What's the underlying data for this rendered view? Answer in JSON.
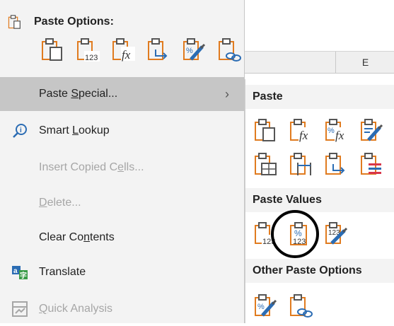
{
  "sheet": {
    "column_label": "E"
  },
  "menu": {
    "paste_options_label": "Paste Options:",
    "paste_special": {
      "prefix": "Paste ",
      "underlined": "S",
      "suffix": "pecial...",
      "arrow": "›"
    },
    "smart_lookup": {
      "prefix": "Smart ",
      "underlined": "L",
      "suffix": "ookup"
    },
    "insert_copied": {
      "prefix": "Insert Copied C",
      "underlined": "e",
      "suffix": "lls..."
    },
    "delete": {
      "prefix": "",
      "underlined": "D",
      "suffix": "elete..."
    },
    "clear_contents": {
      "prefix": "Clear Co",
      "underlined": "n",
      "suffix": "tents"
    },
    "translate": {
      "label": "Translate"
    },
    "quick_analysis": {
      "prefix": "",
      "underlined": "Q",
      "suffix": "uick Analysis"
    }
  },
  "submenu": {
    "paste_header": "Paste",
    "paste_values_header": "Paste Values",
    "other_header": "Other Paste Options"
  },
  "colors": {
    "accent": "#2b6cb3",
    "orange": "#e07b1f",
    "highlight": "#c6c6c6"
  }
}
